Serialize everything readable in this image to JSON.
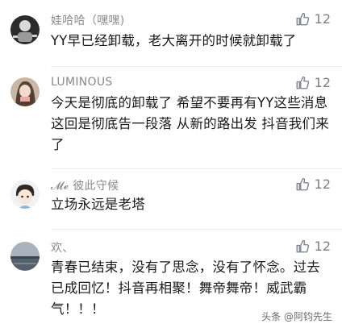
{
  "comments": [
    {
      "username": "娃哈哈（嘿嘿)",
      "likes": "12",
      "text": "YY早已经卸载，老大离开的时候就卸载了",
      "avatar_icon": "dark-character-avatar"
    },
    {
      "username": "LUMINOUS",
      "likes": "12",
      "text": "今天是彻底的卸载了 希望不要再有YY这些消息这回是彻底告一段落 从新的路出发 抖音我们来了",
      "avatar_icon": "girl-photo-avatar"
    },
    {
      "username": "𝓜𝓮 彼此守候",
      "likes": "12",
      "text": "立场永远是老塔",
      "avatar_icon": "cartoon-boy-avatar"
    },
    {
      "username": "欢、",
      "likes": "12",
      "text": "青春已结束，没有了思念，没有了怀念。过去已成回忆！抖音再相聚！舞帝舞帝！威武霸气！！！",
      "avatar_icon": "seascape-avatar"
    }
  ],
  "watermark": "头条 @阿钧先生",
  "colors": {
    "username": "#8a8a8a",
    "text": "#1a1a1a",
    "like": "#7a7f8c"
  }
}
